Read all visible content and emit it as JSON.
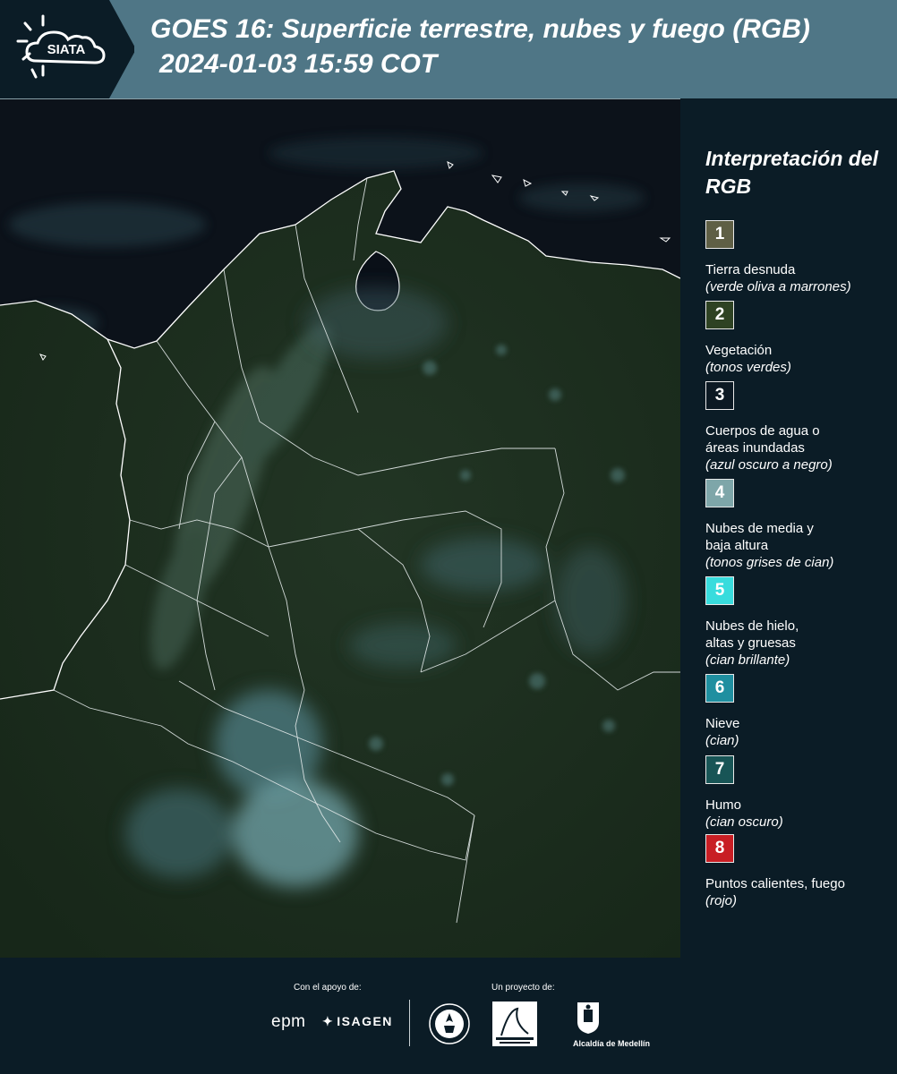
{
  "header": {
    "logo_text": "SIATA",
    "title_line1": "GOES 16: Superficie terrestre, nubes y fuego (RGB)",
    "title_line2": "2024-01-03 15:59 COT"
  },
  "legend": {
    "title": "Interpretación del RGB",
    "items": [
      {
        "number": "1",
        "label": "Tierra desnuda",
        "desc": "(verde oliva a marrones)",
        "color": "#5f5f45"
      },
      {
        "number": "2",
        "label": "Vegetación",
        "desc": "(tonos verdes)",
        "color": "#2e4223"
      },
      {
        "number": "3",
        "label": "Cuerpos de agua o\náreas inundadas",
        "desc": "(azul oscuro a negro)",
        "color": "#0c1923"
      },
      {
        "number": "4",
        "label": "Nubes de media y\nbaja altura",
        "desc": "(tonos grises de cian)",
        "color": "#7ea6a9"
      },
      {
        "number": "5",
        "label": "Nubes de hielo,\naltas y gruesas",
        "desc": "(cian brillante)",
        "color": "#38dcdd"
      },
      {
        "number": "6",
        "label": "Nieve",
        "desc": "(cian)",
        "color": "#1f8fa0"
      },
      {
        "number": "7",
        "label": "Humo",
        "desc": "(cian oscuro)",
        "color": "#185556"
      },
      {
        "number": "8",
        "label": "Puntos calientes, fuego",
        "desc": "(rojo)",
        "color": "#c81e24"
      }
    ]
  },
  "footer": {
    "support_label": "Con el apoyo de:",
    "project_label": "Un proyecto de:",
    "sponsors": [
      "epm",
      "ISAGEN"
    ],
    "partners": [
      "Alcaldía de Medellín"
    ]
  }
}
